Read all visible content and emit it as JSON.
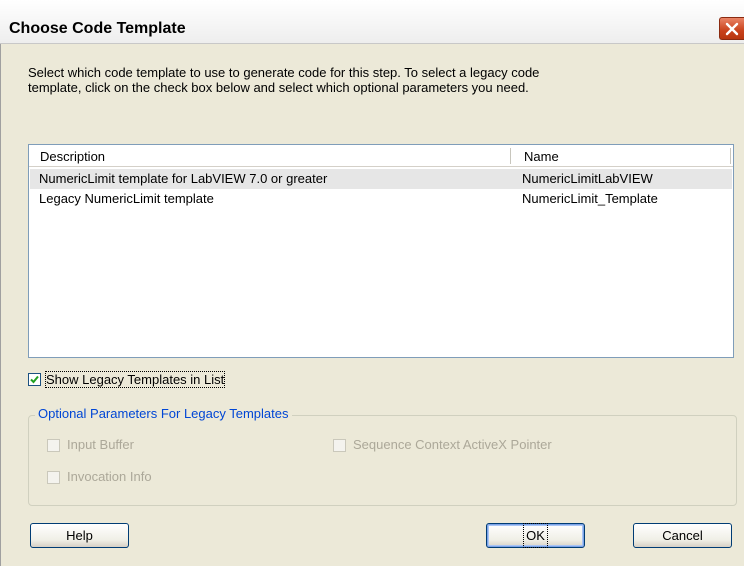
{
  "window": {
    "title": "Choose Code Template"
  },
  "instructions": {
    "line1": "Select which code template to use to generate code for this step. To select a legacy code",
    "line2": "template, click on the check box below and select which optional parameters you need."
  },
  "template_list": {
    "columns": [
      "Description",
      "Name"
    ],
    "rows": [
      {
        "description": "NumericLimit template for LabVIEW 7.0 or greater",
        "name": "NumericLimitLabVIEW",
        "selected": true
      },
      {
        "description": "Legacy NumericLimit template",
        "name": "NumericLimit_Template",
        "selected": false
      }
    ]
  },
  "show_legacy": {
    "label": "Show Legacy Templates in List",
    "checked": true
  },
  "optional_params": {
    "legend": "Optional Parameters For Legacy Templates",
    "input_buffer": {
      "label": "Input Buffer",
      "checked": false,
      "enabled": false
    },
    "sequence_context": {
      "label": "Sequence Context ActiveX Pointer",
      "checked": false,
      "enabled": false
    },
    "invocation_info": {
      "label": "Invocation Info",
      "checked": false,
      "enabled": false
    }
  },
  "buttons": {
    "help": "Help",
    "ok": "OK",
    "cancel": "Cancel"
  },
  "colors": {
    "dialog_bg": "#ece9d8",
    "close_button": "#c9421c",
    "group_legend": "#0046d5",
    "checkmark": "#21a121"
  },
  "icons": {
    "close": "close-icon",
    "check": "checkmark-icon"
  }
}
